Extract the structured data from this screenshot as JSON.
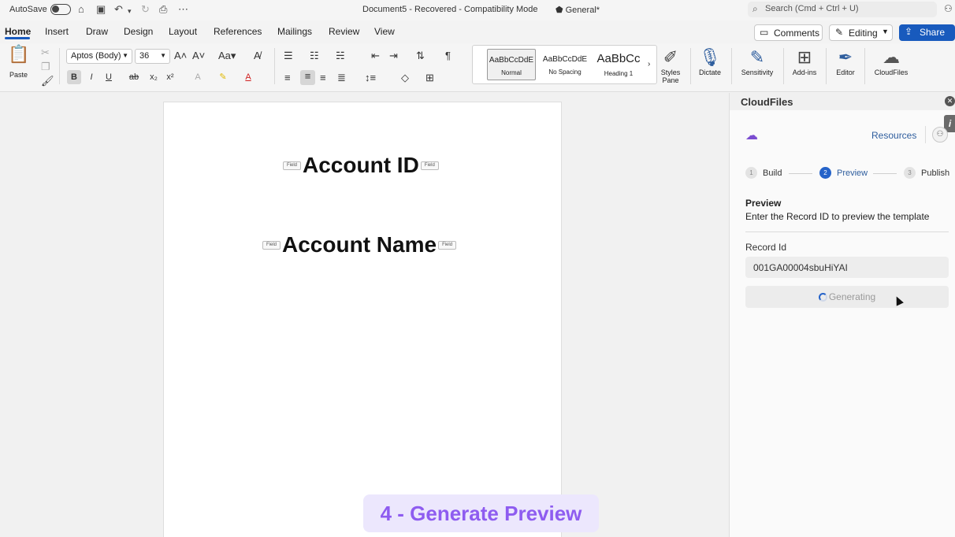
{
  "titlebar": {
    "autosave_label": "AutoSave",
    "document_title": "Document5  -  Recovered  -  Compatibility Mode",
    "sensitivity_label": "General*",
    "search_placeholder": "Search (Cmd + Ctrl + U)"
  },
  "tabs": [
    "Home",
    "Insert",
    "Draw",
    "Design",
    "Layout",
    "References",
    "Mailings",
    "Review",
    "View"
  ],
  "active_tab": "Home",
  "actions": {
    "comments": "Comments",
    "editing": "Editing",
    "share": "Share"
  },
  "ribbon": {
    "paste_label": "Paste",
    "font_name": "Aptos (Body)",
    "font_size": "36",
    "styles": [
      {
        "sample": "AaBbCcDdE",
        "name": "Normal"
      },
      {
        "sample": "AaBbCcDdE",
        "name": "No Spacing"
      },
      {
        "sample": "AaBbCc",
        "name": "Heading 1"
      }
    ],
    "tools": {
      "styles_pane": "Styles Pane",
      "dictate": "Dictate",
      "sensitivity": "Sensitivity",
      "addins": "Add-ins",
      "editor": "Editor",
      "cloudfiles": "CloudFiles"
    }
  },
  "document": {
    "fields": [
      {
        "tag_left": "Field",
        "text": "Account ID",
        "tag_right": "Field"
      },
      {
        "tag_left": "Field",
        "text": "Account Name",
        "tag_right": "Field"
      }
    ]
  },
  "panel": {
    "title": "CloudFiles",
    "resources_link": "Resources",
    "steps": [
      {
        "num": "1",
        "label": "Build"
      },
      {
        "num": "2",
        "label": "Preview"
      },
      {
        "num": "3",
        "label": "Publish"
      }
    ],
    "active_step": 2,
    "preview_title": "Preview",
    "preview_description": "Enter the Record ID to preview the template",
    "record_label": "Record Id",
    "record_value": "001GA00004sbuHiYAI",
    "generate_label": "Generating"
  },
  "banner": "4 - Generate Preview",
  "colors": {
    "accent": "#185abd",
    "step_active": "#2563c9",
    "banner_text": "#8e5cf0",
    "banner_bg": "#ece7fd"
  }
}
